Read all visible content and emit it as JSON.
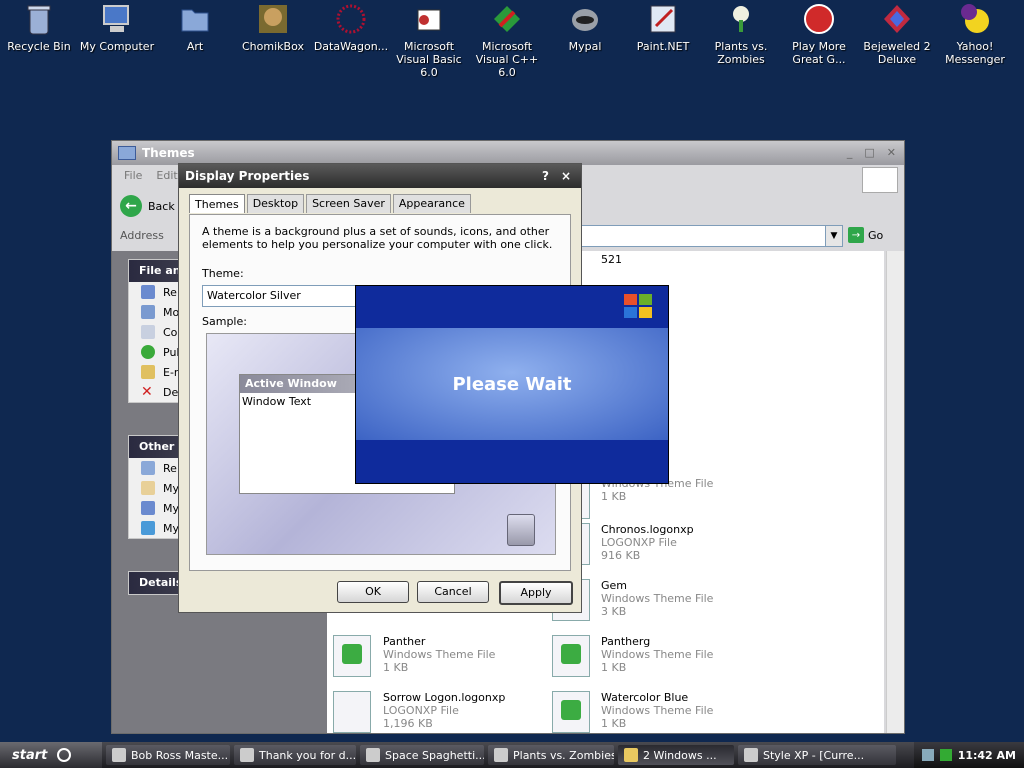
{
  "desktop_icons": [
    {
      "label": "Recycle Bin",
      "icon": "recycle-bin-icon"
    },
    {
      "label": "My Computer",
      "icon": "my-computer-icon"
    },
    {
      "label": "Art",
      "icon": "folder-icon"
    },
    {
      "label": "ChomikBox",
      "icon": "chomikbox-icon"
    },
    {
      "label": "DataWagon...",
      "icon": "datawagon-icon"
    },
    {
      "label": "Microsoft Visual Basic 6.0",
      "icon": "visual-basic-icon"
    },
    {
      "label": "Microsoft Visual C++ 6.0",
      "icon": "visual-cpp-icon"
    },
    {
      "label": "Mypal",
      "icon": "mypal-icon"
    },
    {
      "label": "Paint.NET",
      "icon": "paint-net-icon"
    },
    {
      "label": "Plants vs. Zombies",
      "icon": "plants-vs-zombies-icon"
    },
    {
      "label": "Play More Great G...",
      "icon": "popcap-icon"
    },
    {
      "label": "Bejeweled 2 Deluxe",
      "icon": "bejeweled-icon"
    },
    {
      "label": "Yahoo! Messenger",
      "icon": "yahoo-messenger-icon"
    }
  ],
  "explorer": {
    "title": "Themes",
    "menu": [
      "File",
      "Edit"
    ],
    "back_label": "Back",
    "address_label": "Address",
    "go_label": "Go",
    "panels": [
      {
        "header": "File and",
        "items": [
          "Re",
          "Mo",
          "Co",
          "Pul",
          "E-r",
          "De"
        ]
      },
      {
        "header": "Other P",
        "items": [
          "Re",
          "My",
          "My",
          "My"
        ]
      },
      {
        "header": "Details",
        "items": []
      }
    ],
    "files": [
      {
        "name": "521",
        "type": "",
        "size": ""
      },
      {
        "name": "",
        "type": "Windows Theme File",
        "size": "1 KB"
      },
      {
        "name": "Chronos.logonxp",
        "type": "LOGONXP File",
        "size": "916 KB"
      },
      {
        "name": "",
        "type": "",
        "size": ""
      },
      {
        "name": "Gem",
        "type": "Windows Theme File",
        "size": "3 KB"
      },
      {
        "name": "Panther",
        "type": "Windows Theme File",
        "size": "1 KB"
      },
      {
        "name": "Pantherg",
        "type": "Windows Theme File",
        "size": "1 KB"
      },
      {
        "name": "Sorrow Logon.logonxp",
        "type": "LOGONXP File",
        "size": "1,196 KB"
      },
      {
        "name": "Watercolor Blue",
        "type": "Windows Theme File",
        "size": "1 KB"
      }
    ]
  },
  "dialog": {
    "title": "Display Properties",
    "help": "?",
    "close": "×",
    "tabs": [
      "Themes",
      "Desktop",
      "Screen Saver",
      "Appearance"
    ],
    "description": "A theme is a background plus a set of sounds, icons, and other elements to help you personalize your computer with one click.",
    "theme_label": "Theme:",
    "theme_value": "Watercolor Silver",
    "sample_label": "Sample:",
    "active_window": "Active Window",
    "window_text": "Window Text",
    "buttons": {
      "ok": "OK",
      "cancel": "Cancel",
      "apply": "Apply"
    }
  },
  "splash": {
    "message": "Please Wait"
  },
  "taskbar": {
    "start_label": "start",
    "tasks": [
      {
        "label": "Bob Ross Maste...",
        "active": false
      },
      {
        "label": "Thank you for d...",
        "active": false
      },
      {
        "label": "Space Spaghetti...",
        "active": false
      },
      {
        "label": "Plants vs. Zombies",
        "active": false
      },
      {
        "label": "2 Windows ...",
        "active": true
      },
      {
        "label": "Style XP - [Curre...",
        "active": false
      }
    ],
    "clock": "11:42 AM"
  }
}
